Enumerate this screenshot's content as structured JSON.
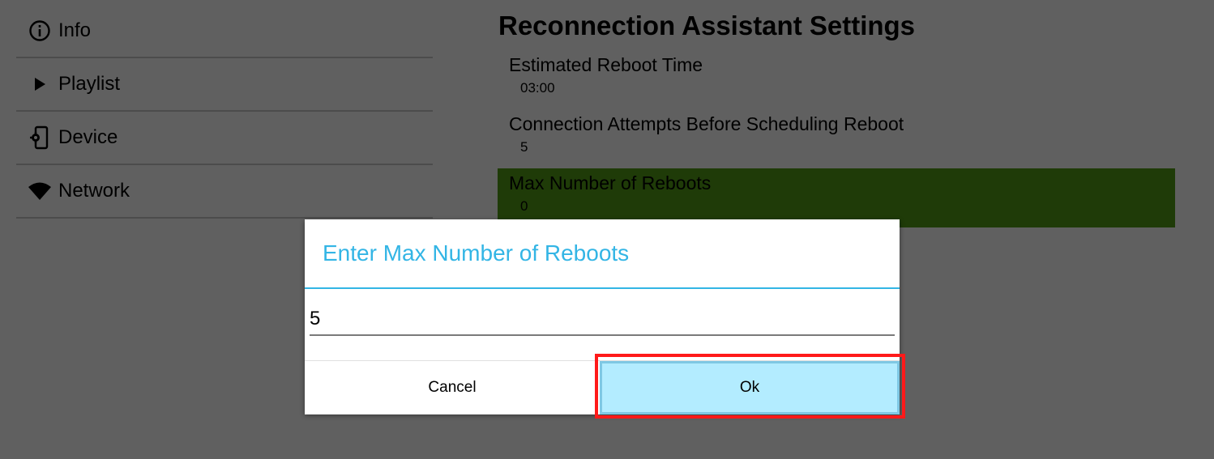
{
  "sidebar": {
    "items": [
      {
        "label": "Info",
        "icon": "info-icon"
      },
      {
        "label": "Playlist",
        "icon": "play-icon"
      },
      {
        "label": "Device",
        "icon": "device-settings-icon"
      },
      {
        "label": "Network",
        "icon": "wifi-icon"
      }
    ]
  },
  "settings": {
    "title": "Reconnection Assistant Settings",
    "rows": [
      {
        "title": "Estimated Reboot Time",
        "value": "03:00"
      },
      {
        "title": "Connection Attempts Before Scheduling Reboot",
        "value": "5"
      },
      {
        "title": "Max Number of Reboots",
        "value": "0"
      }
    ]
  },
  "dialog": {
    "title": "Enter Max Number of Reboots",
    "input_value": "5",
    "cancel_label": "Cancel",
    "ok_label": "Ok"
  },
  "colors": {
    "background": "#606060",
    "active_row": "#1f3b08",
    "dialog_accent": "#33b5e5",
    "ok_button": "#b3ecff",
    "highlight": "#ff1a1a"
  }
}
